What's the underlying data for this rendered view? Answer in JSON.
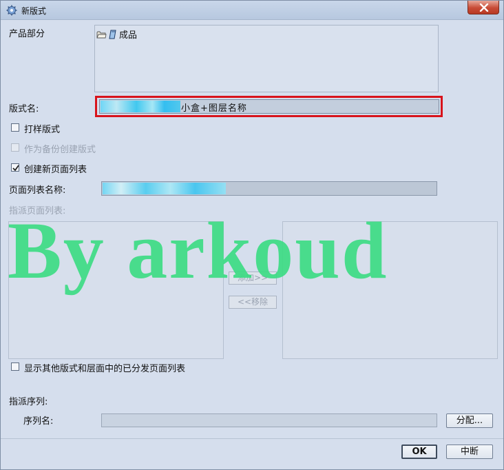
{
  "window": {
    "title": "新版式",
    "close_label": "✕"
  },
  "product": {
    "label": "产品部分",
    "item": "成品"
  },
  "layout_name": {
    "label": "版式名:",
    "value_text": "小盒+图层名称"
  },
  "options": {
    "proof": "打样版式",
    "backup": "作为备份创建版式",
    "create_list": "创建新页面列表"
  },
  "page_list": {
    "label": "页面列表名称:"
  },
  "assign_pages": {
    "label": "指派页面列表:",
    "add_button": "添加>>",
    "remove_button": "<<移除"
  },
  "show_other": "显示其他版式和层面中的已分发页面列表",
  "sequence": {
    "label": "指派序列:",
    "name_label": "序列名:",
    "assign_button": "分配..."
  },
  "footer": {
    "ok": "OK",
    "cancel": "中断"
  },
  "watermark": "By arkoud",
  "checkbox_state": {
    "proof": false,
    "backup": false,
    "create_list": true,
    "show_other": false
  }
}
